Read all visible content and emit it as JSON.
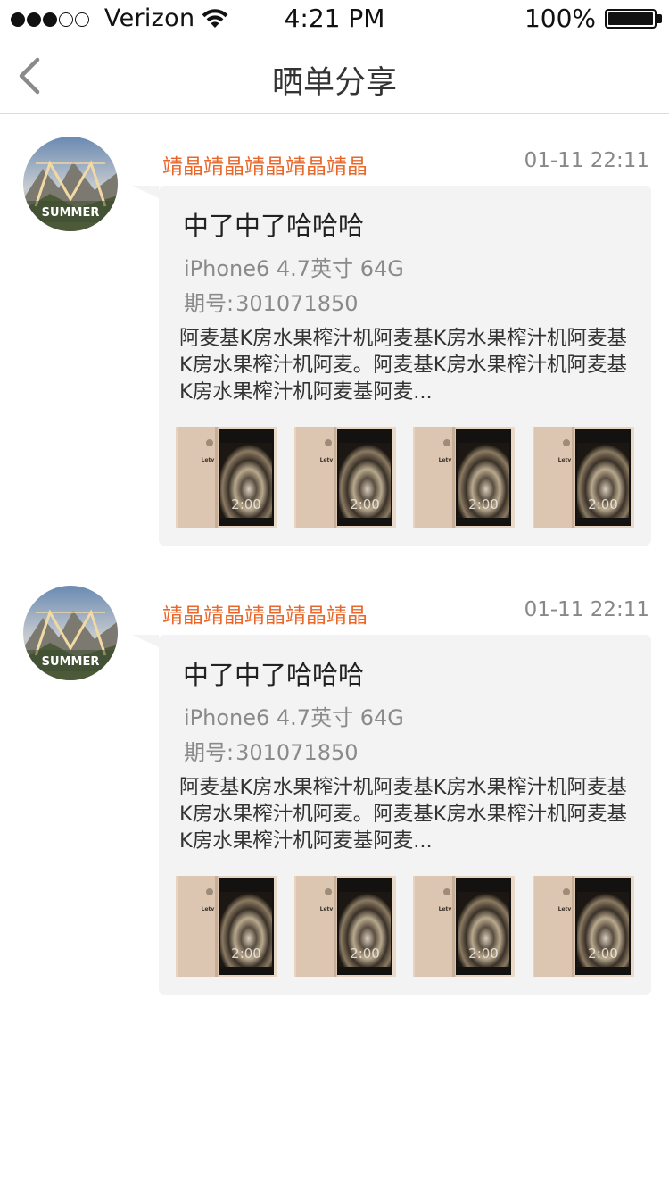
{
  "status_bar": {
    "carrier": "Verizon",
    "signal_bars_filled": 3,
    "signal_bars_total": 5,
    "time": "4:21 PM",
    "battery": "100%",
    "battery_level": 1.0
  },
  "nav": {
    "title": "晒单分享",
    "back_icon": "chevron-left-icon"
  },
  "colors": {
    "accent": "#e8672a",
    "bubble_bg": "#f3f3f3"
  },
  "posts": [
    {
      "username": "靖晶靖晶靖晶靖晶靖晶",
      "timestamp": "01-11 22:11",
      "title": "中了中了哈哈哈",
      "product": "iPhone6 4.7英寸 64G",
      "issue_label": "期号:",
      "issue_value": "301071850",
      "description": "阿麦基K房水果榨汁机阿麦基K房水果榨汁机阿麦基K房水果榨汁机阿麦。阿麦基K房水果榨汁机阿麦基K房水果榨汁机阿麦基阿麦...",
      "avatar_text": "SUMMER",
      "thumbnails": [
        {
          "brand": "Letv",
          "clock": "2:00"
        },
        {
          "brand": "Letv",
          "clock": "2:00"
        },
        {
          "brand": "Letv",
          "clock": "2:00"
        },
        {
          "brand": "Letv",
          "clock": "2:00"
        }
      ]
    },
    {
      "username": "靖晶靖晶靖晶靖晶靖晶",
      "timestamp": "01-11 22:11",
      "title": "中了中了哈哈哈",
      "product": "iPhone6 4.7英寸 64G",
      "issue_label": "期号:",
      "issue_value": "301071850",
      "description": "阿麦基K房水果榨汁机阿麦基K房水果榨汁机阿麦基K房水果榨汁机阿麦。阿麦基K房水果榨汁机阿麦基K房水果榨汁机阿麦基阿麦...",
      "avatar_text": "SUMMER",
      "thumbnails": [
        {
          "brand": "Letv",
          "clock": "2:00"
        },
        {
          "brand": "Letv",
          "clock": "2:00"
        },
        {
          "brand": "Letv",
          "clock": "2:00"
        },
        {
          "brand": "Letv",
          "clock": "2:00"
        }
      ]
    }
  ]
}
